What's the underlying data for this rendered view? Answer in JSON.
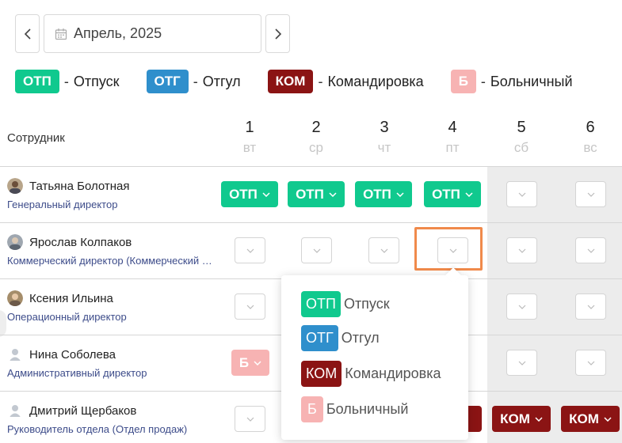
{
  "date_picker": {
    "value": "Апрель, 2025",
    "prev_icon": "chevron-left-icon",
    "next_icon": "chevron-right-icon",
    "calendar_icon": "calendar-icon"
  },
  "legend": [
    {
      "code": "ОТП",
      "label": "Отпуск",
      "color": "#10c98e"
    },
    {
      "code": "ОТГ",
      "label": "Отгул",
      "color": "#2f8fcc"
    },
    {
      "code": "КОМ",
      "label": "Командировка",
      "color": "#8b1414"
    },
    {
      "code": "Б",
      "label": "Больничный",
      "color": "#f7b3b3"
    }
  ],
  "legend_separator": "-",
  "table": {
    "employee_header": "Сотрудник",
    "days": [
      {
        "num": "1",
        "dow": "вт"
      },
      {
        "num": "2",
        "dow": "ср"
      },
      {
        "num": "3",
        "dow": "чт"
      },
      {
        "num": "4",
        "dow": "пт"
      },
      {
        "num": "5",
        "dow": "сб"
      },
      {
        "num": "6",
        "dow": "вс"
      }
    ],
    "employees": [
      {
        "name": "Татьяна Болотная",
        "role": "Генеральный директор"
      },
      {
        "name": "Ярослав Колпаков",
        "role": "Коммерческий директор (Коммерческий отдел)"
      },
      {
        "name": "Ксения Ильина",
        "role": "Операционный директор"
      },
      {
        "name": "Нина Соболева",
        "role": "Административный директор"
      },
      {
        "name": "Дмитрий Щербаков",
        "role": "Руководитель отдела (Отдел продаж)"
      }
    ]
  },
  "tags": {
    "otp": "ОТП",
    "kom": "КОМ",
    "b": "Б"
  },
  "popover": [
    {
      "code": "ОТП",
      "label": "Отпуск"
    },
    {
      "code": "ОТГ",
      "label": "Отгул"
    },
    {
      "code": "КОМ",
      "label": "Командировка"
    },
    {
      "code": "Б",
      "label": "Больничный"
    }
  ]
}
